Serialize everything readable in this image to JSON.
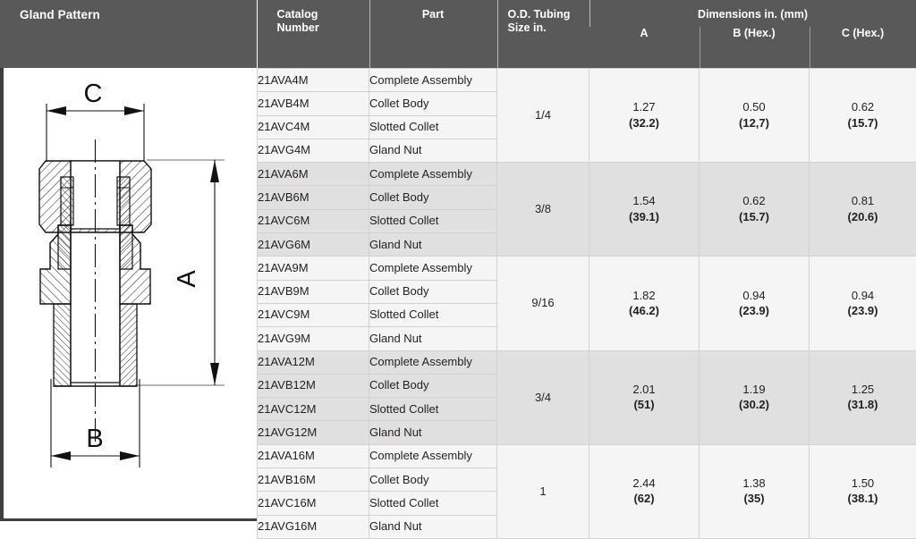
{
  "panel": {
    "title": "Gland Pattern",
    "labels": {
      "a": "A",
      "b": "B",
      "c": "C"
    }
  },
  "table": {
    "headers": {
      "catalog_line1": "Catalog",
      "catalog_line2": "Number",
      "part": "Part",
      "od_line1": "O.D. Tubing",
      "od_line2": "Size in.",
      "dimensions_group": "Dimensions in. (mm)",
      "dim_a": "A",
      "dim_b": "B (Hex.)",
      "dim_c": "C (Hex.)"
    },
    "groups": [
      {
        "od_size": "1/4",
        "a_inch": "1.27",
        "a_mm": "(32.2)",
        "b_inch": "0.50",
        "b_mm": "(12,7)",
        "c_inch": "0.62",
        "c_mm": "(15.7)",
        "rows": [
          {
            "catalog": "21AVA4M",
            "part": "Complete Assembly"
          },
          {
            "catalog": "21AVB4M",
            "part": "Collet Body"
          },
          {
            "catalog": "21AVC4M",
            "part": "Slotted Collet"
          },
          {
            "catalog": "21AVG4M",
            "part": "Gland Nut"
          }
        ]
      },
      {
        "od_size": "3/8",
        "a_inch": "1.54",
        "a_mm": "(39.1)",
        "b_inch": "0.62",
        "b_mm": "(15.7)",
        "c_inch": "0.81",
        "c_mm": "(20.6)",
        "rows": [
          {
            "catalog": "21AVA6M",
            "part": "Complete Assembly"
          },
          {
            "catalog": "21AVB6M",
            "part": "Collet Body"
          },
          {
            "catalog": "21AVC6M",
            "part": "Slotted Collet"
          },
          {
            "catalog": "21AVG6M",
            "part": "Gland Nut"
          }
        ]
      },
      {
        "od_size": "9/16",
        "a_inch": "1.82",
        "a_mm": "(46.2)",
        "b_inch": "0.94",
        "b_mm": "(23.9)",
        "c_inch": "0.94",
        "c_mm": "(23.9)",
        "rows": [
          {
            "catalog": "21AVA9M",
            "part": "Complete Assembly"
          },
          {
            "catalog": "21AVB9M",
            "part": "Collet Body"
          },
          {
            "catalog": "21AVC9M",
            "part": "Slotted Collet"
          },
          {
            "catalog": "21AVG9M",
            "part": "Gland Nut"
          }
        ]
      },
      {
        "od_size": "3/4",
        "a_inch": "2.01",
        "a_mm": "(51)",
        "b_inch": "1.19",
        "b_mm": "(30.2)",
        "c_inch": "1.25",
        "c_mm": "(31.8)",
        "rows": [
          {
            "catalog": "21AVA12M",
            "part": "Complete Assembly"
          },
          {
            "catalog": "21AVB12M",
            "part": "Collet Body"
          },
          {
            "catalog": "21AVC12M",
            "part": "Slotted Collet"
          },
          {
            "catalog": "21AVG12M",
            "part": "Gland Nut"
          }
        ]
      },
      {
        "od_size": "1",
        "a_inch": "2.44",
        "a_mm": "(62)",
        "b_inch": "1.38",
        "b_mm": "(35)",
        "c_inch": "1.50",
        "c_mm": "(38.1)",
        "rows": [
          {
            "catalog": "21AVA16M",
            "part": "Complete Assembly"
          },
          {
            "catalog": "21AVB16M",
            "part": "Collet Body"
          },
          {
            "catalog": "21AVC16M",
            "part": "Slotted Collet"
          },
          {
            "catalog": "21AVG16M",
            "part": "Gland Nut"
          }
        ]
      }
    ]
  },
  "colors": {
    "header_bg": "#59595a",
    "row_light": "#f5f5f5",
    "row_dark": "#e0e0e0",
    "grid": "#d2d2d2",
    "text": "#231f20",
    "panel_border": "#3f3f41"
  }
}
